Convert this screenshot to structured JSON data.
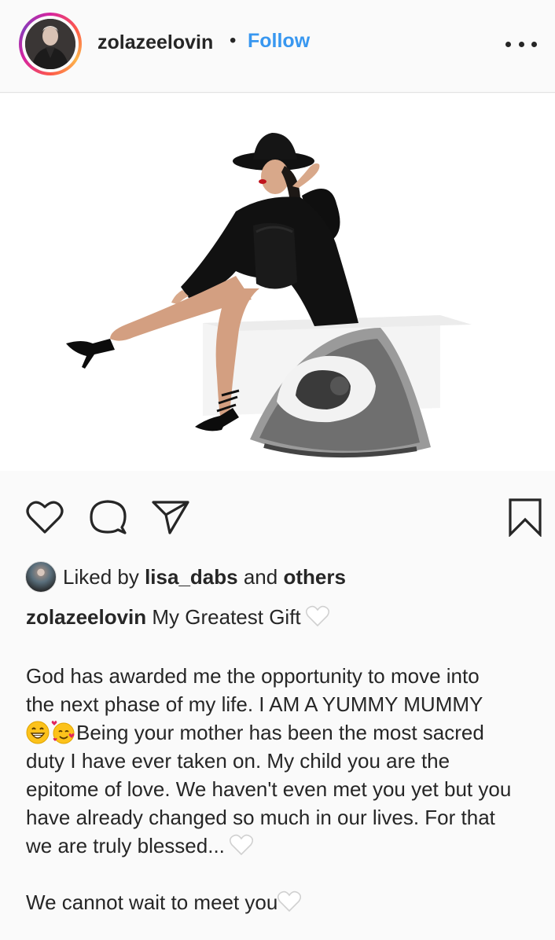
{
  "post": {
    "username": "zolazeelovin",
    "separator": "•",
    "follow_label": "Follow",
    "more_icon": "more-horizontal-icon"
  },
  "actions": {
    "icons": [
      "heart-icon",
      "comment-icon",
      "share-icon",
      "bookmark-icon"
    ]
  },
  "likes": {
    "prefix": "Liked by",
    "user": "lisa_dabs",
    "middle": "and",
    "suffix": "others"
  },
  "caption": {
    "username": "zolazeelovin",
    "title": "My Greatest Gift",
    "line1": "God has awarded me the opportunity to move into",
    "line2": "the next phase of my life. I AM A YUMMY MUMMY",
    "line3": "Being your mother has been the most sacred",
    "line4": "duty I have ever taken on. My child you are the",
    "line5": "epitome of love. We haven't even met you yet but you",
    "line6": "have already changed so much in our lives. For that",
    "line7": "we are truly blessed...",
    "closing": "We cannot wait to meet you"
  },
  "colors": {
    "accent": "#3897f0",
    "text": "#262626",
    "background": "#fafafa"
  }
}
